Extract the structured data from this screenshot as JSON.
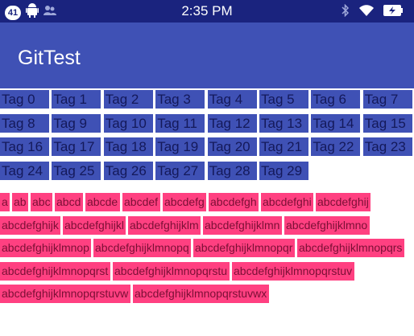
{
  "status_bar": {
    "notification_count": "41",
    "time": "2:35 PM"
  },
  "app_bar": {
    "title": "GitTest"
  },
  "tags": [
    "Tag 0",
    "Tag 1",
    "Tag 2",
    "Tag 3",
    "Tag 4",
    "Tag 5",
    "Tag 6",
    "Tag 7",
    "Tag 8",
    "Tag 9",
    "Tag 10",
    "Tag 11",
    "Tag 12",
    "Tag 13",
    "Tag 14",
    "Tag 15",
    "Tag 16",
    "Tag 17",
    "Tag 18",
    "Tag 19",
    "Tag 20",
    "Tag 21",
    "Tag 22",
    "Tag 23",
    "Tag 24",
    "Tag 25",
    "Tag 26",
    "Tag 27",
    "Tag 28",
    "Tag 29"
  ],
  "words": [
    "a",
    "ab",
    "abc",
    "abcd",
    "abcde",
    "abcdef",
    "abcdefg",
    "abcdefgh",
    "abcdefghi",
    "abcdefghij",
    "abcdefghijk",
    "abcdefghijkl",
    "abcdefghijklm",
    "abcdefghijklmn",
    "abcdefghijklmno",
    "abcdefghijklmnop",
    "abcdefghijklmnopq",
    "abcdefghijklmnopqr",
    "abcdefghijklmnopqrs",
    "abcdefghijklmnopqrst",
    "abcdefghijklmnopqrstu",
    "abcdefghijklmnopqrstuv",
    "abcdefghijklmnopqrstuvw",
    "abcdefghijklmnopqrstuvwx"
  ],
  "colors": {
    "status_bar": "#1a237e",
    "primary": "#3f51b5",
    "accent": "#ff4081"
  }
}
